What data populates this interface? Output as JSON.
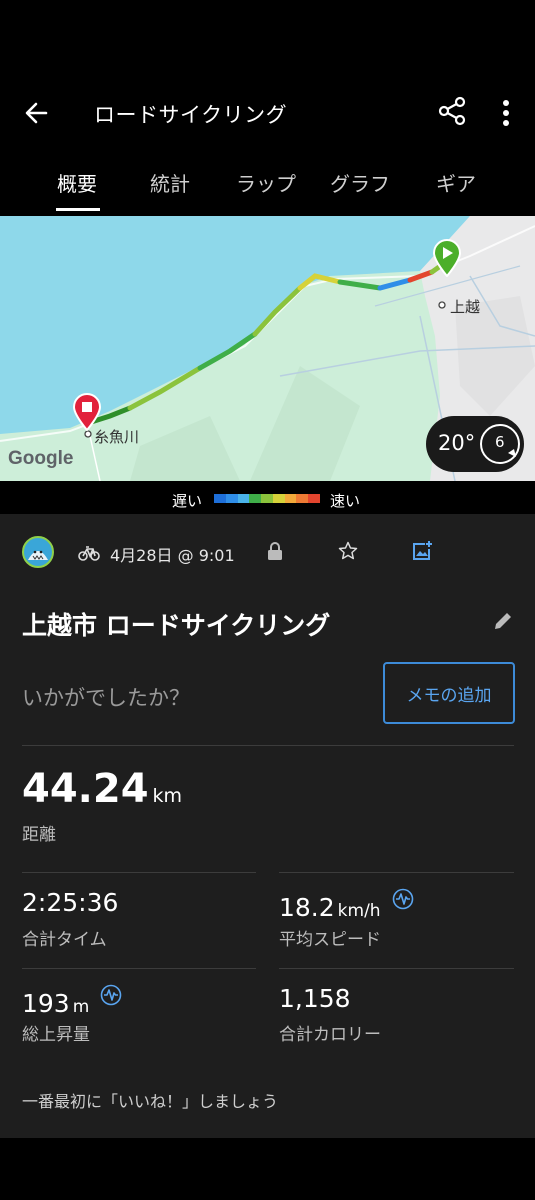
{
  "appbar": {
    "title": "ロードサイクリング",
    "back_icon": "arrow-left-icon",
    "share_icon": "share-icon",
    "more_icon": "more-vertical-icon"
  },
  "tabs": [
    {
      "label": "概要",
      "active": true
    },
    {
      "label": "統計",
      "active": false
    },
    {
      "label": "ラップ",
      "active": false
    },
    {
      "label": "グラフ",
      "active": false
    },
    {
      "label": "ギア",
      "active": false
    }
  ],
  "map": {
    "start_place": "上越",
    "end_place": "糸魚川",
    "logo": "Google",
    "temperature": "20°",
    "wind": "6",
    "colors": {
      "sea": "#8ed8ea",
      "land": "#cdeed9",
      "urban": "#e9e9ea"
    }
  },
  "legend": {
    "slow": "遅い",
    "fast": "速い",
    "colors": [
      "#1e6fd9",
      "#2f8ee8",
      "#4ab3e9",
      "#3fae49",
      "#8bc33c",
      "#d6d23a",
      "#f2a93a",
      "#ee7a34",
      "#e3452e"
    ]
  },
  "activity": {
    "avatar_icon": "shark-avatar-icon",
    "sport_icon": "bicycle-icon",
    "date": "4月28日 @ 9:01",
    "lock_icon": "lock-icon",
    "star_icon": "star-icon",
    "photo_icon": "add-photo-icon",
    "title": "上越市 ロードサイクリング",
    "edit_icon": "pencil-icon",
    "prompt": "いかがでしたか？",
    "memo_button": "メモの追加"
  },
  "stats": {
    "distance": {
      "value": "44.24",
      "unit": "km",
      "label": "距離"
    },
    "total_time": {
      "value": "2:25:36",
      "label": "合計タイム"
    },
    "avg_speed": {
      "value": "18.2",
      "unit": "km/h",
      "label": "平均スピード"
    },
    "ascent": {
      "value": "193",
      "unit": "m",
      "label": "総上昇量"
    },
    "calories": {
      "value": "1,158",
      "label": "合計カロリー"
    }
  },
  "like_text": "一番最初に「いいね！」しましょう",
  "accent": "#3d8bd8"
}
